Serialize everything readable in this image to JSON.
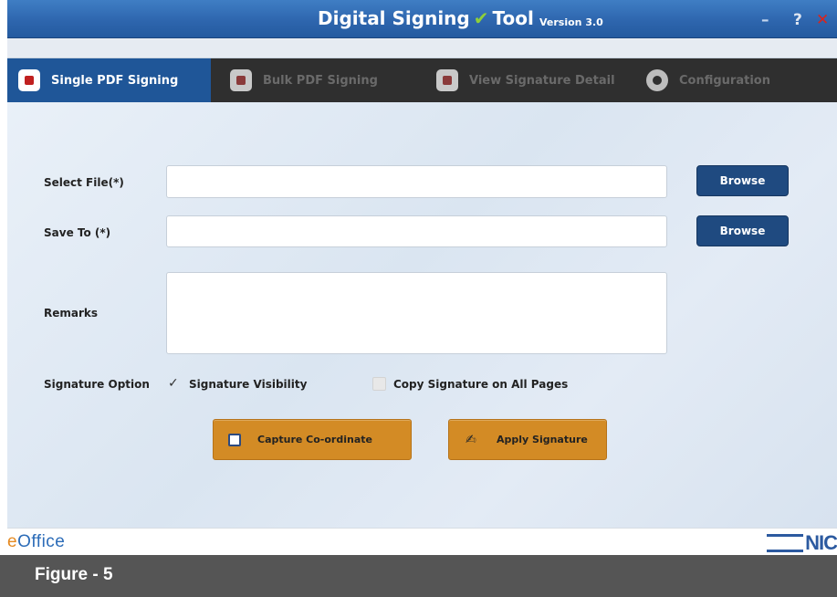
{
  "window": {
    "title_part1": "Digital Signing",
    "title_part2": "Tool",
    "version": "Version 3.0",
    "minimize": "–",
    "help": "?",
    "close": "✕"
  },
  "tabs": [
    {
      "label": "Single PDF Signing",
      "active": true
    },
    {
      "label": "Bulk PDF Signing",
      "active": false
    },
    {
      "label": "View Signature Detail",
      "active": false
    },
    {
      "label": "Configuration",
      "active": false
    }
  ],
  "form": {
    "select_file_label": "Select File(*)",
    "select_file_value": "",
    "save_to_label": "Save To (*)",
    "save_to_value": "",
    "browse_label": "Browse",
    "remarks_label": "Remarks",
    "remarks_value": "",
    "signature_option_label": "Signature Option",
    "signature_visibility_label": "Signature Visibility",
    "signature_visibility_checked": true,
    "copy_signature_label": "Copy Signature on All Pages",
    "copy_signature_checked": false
  },
  "actions": {
    "capture_label": "Capture Co-ordinate",
    "apply_label": "Apply Signature"
  },
  "footer": {
    "logo_left_prefix": "e",
    "logo_left_rest": "Office",
    "logo_right": "NIC"
  },
  "caption": "Figure - 5",
  "colors": {
    "titlebar": "#2e66ae",
    "tab_active": "#1f5698",
    "tab_strip": "#2f2f2f",
    "browse_button": "#1f4a80",
    "action_button": "#d38b25",
    "close_button": "#d9241c",
    "caption_bar": "#555555"
  }
}
